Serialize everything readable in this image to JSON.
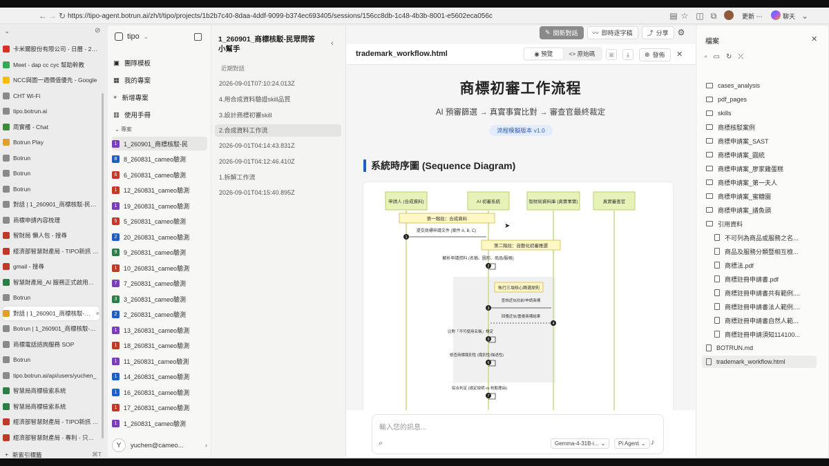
{
  "browser": {
    "url": "https://tipo-agent.botrun.ai/zh/t/tipo/projects/1b2b7c40-8daa-4ddf-9099-b374ec693405/sessions/156cc8db-1c48-4b3b-8001-e5602eca056c",
    "update_label": "更新",
    "chat_label": "聊天",
    "new_tab_label": "新索引標籤",
    "new_tab_shortcut": "⌘T",
    "tabs": [
      {
        "title": "卡米爾股份有限公司 - 日曆 - 2026",
        "color": "#d93025"
      },
      {
        "title": "Meet - dap cc cyc 幫助幹教",
        "color": "#34a853"
      },
      {
        "title": "NCC與圖一週價值優先 - Google",
        "color": "#fbbc04"
      },
      {
        "title": "CHT Wi-Fi",
        "color": "#8a8a8a"
      },
      {
        "title": "tipo.botrun.ai",
        "color": "#8a8a8a"
      },
      {
        "title": "周實穫 - Chat",
        "color": "#3c8c3c"
      },
      {
        "title": "Botrun Play",
        "color": "#e0a030"
      },
      {
        "title": "Botrun",
        "color": "#8a8a8a"
      },
      {
        "title": "Botrun",
        "color": "#8a8a8a"
      },
      {
        "title": "Botrun",
        "color": "#8a8a8a"
      },
      {
        "title": "對話 | 1_260901_商標核駁-民眾問",
        "color": "#8a8a8a"
      },
      {
        "title": "商標申請內容梳理",
        "color": "#8a8a8a"
      },
      {
        "title": "智財局 懶人包 - 搜尋",
        "color": "#c0392b"
      },
      {
        "title": "經濟部智慧財產局 - TIPO新訊 - 智",
        "color": "#c0392b"
      },
      {
        "title": "gmail - 搜尋",
        "color": "#c0392b"
      },
      {
        "title": "智慧財產局_AI 服務正式啟用暨顧問",
        "color": "#2d7d46"
      },
      {
        "title": "Botrun",
        "color": "#8a8a8a"
      },
      {
        "title": "對話 | 1_260901_商標核駁-民眾",
        "color": "#e0a030"
      },
      {
        "title": "Botrun | 1_260901_商標核駁-民眾",
        "color": "#8a8a8a"
      },
      {
        "title": "商標電話諮詢服務 SOP",
        "color": "#8a8a8a"
      },
      {
        "title": "Botrun",
        "color": "#8a8a8a"
      },
      {
        "title": "tipo.botrun.ai/api/users/yuchen_",
        "color": "#8a8a8a"
      },
      {
        "title": "智慧局商標檢索系統",
        "color": "#2d7d46"
      },
      {
        "title": "智慧局商標檢索系統",
        "color": "#2d7d46"
      },
      {
        "title": "經濟部智慧財產局 - TIPO新訊 - 智",
        "color": "#c0392b"
      },
      {
        "title": "經濟部智慧財產局 - 專利 - 只要30",
        "color": "#c0392b"
      }
    ],
    "selected_tab": 17
  },
  "sidebar": {
    "brand": "tipo",
    "nav": [
      {
        "label": "團隊模板",
        "icon": "team-icon"
      },
      {
        "label": "我的專案",
        "icon": "grid-icon"
      },
      {
        "label": "新增專案",
        "icon": "plus-icon"
      },
      {
        "label": "使用手冊",
        "icon": "book-icon"
      }
    ],
    "section_label": "專案",
    "projects": [
      {
        "num": "1",
        "name": "1_260901_商標核駁-民",
        "color": "#7b3fb5"
      },
      {
        "num": "8",
        "name": "8_260831_cameo驗測",
        "color": "#1f5fc4"
      },
      {
        "num": "6",
        "name": "6_260831_cameo驗測",
        "color": "#c0392b"
      },
      {
        "num": "1",
        "name": "12_260831_cameo驗測",
        "color": "#c0392b"
      },
      {
        "num": "1",
        "name": "19_260831_cameo驗測",
        "color": "#7b3fb5"
      },
      {
        "num": "5",
        "name": "5_260831_cameo驗測",
        "color": "#c0392b"
      },
      {
        "num": "2",
        "name": "20_260831_cameo驗測",
        "color": "#1f5fc4"
      },
      {
        "num": "9",
        "name": "9_260831_cameo驗測",
        "color": "#2d7d46"
      },
      {
        "num": "1",
        "name": "10_260831_cameo驗測",
        "color": "#c0392b"
      },
      {
        "num": "7",
        "name": "7_260831_cameo驗測",
        "color": "#7b3fb5"
      },
      {
        "num": "3",
        "name": "3_260831_cameo驗測",
        "color": "#2d7d46"
      },
      {
        "num": "2",
        "name": "2_260831_cameo驗測",
        "color": "#1f5fc4"
      },
      {
        "num": "1",
        "name": "13_260831_cameo驗測",
        "color": "#7b3fb5"
      },
      {
        "num": "1",
        "name": "18_260831_cameo驗測",
        "color": "#c0392b"
      },
      {
        "num": "1",
        "name": "11_260831_cameo驗測",
        "color": "#7b3fb5"
      },
      {
        "num": "1",
        "name": "14_260831_cameo驗測",
        "color": "#1f5fc4"
      },
      {
        "num": "1",
        "name": "16_260831_cameo驗測",
        "color": "#1f5fc4"
      },
      {
        "num": "1",
        "name": "17_260831_cameo驗測",
        "color": "#c0392b"
      },
      {
        "num": "1",
        "name": "1_260831_cameo驗測",
        "color": "#7b3fb5"
      }
    ],
    "user": {
      "initial": "Y",
      "email": "yuchen@cameo..."
    }
  },
  "sessions": {
    "title": "1_260901_商標核駁-民眾問答小幫手",
    "subtitle": "近期對話",
    "items": [
      "2026-09-01T07:10:24.013Z",
      "4.用合成資料驗證skill品質",
      "3.設計商標初審skill",
      "2.合成資料工作流",
      "2026-09-01T04:14:43.831Z",
      "2026-09-01T04:12:46.410Z",
      "1.拆解工作流",
      "2026-09-01T04:15:40.895Z"
    ],
    "selected": 3
  },
  "main": {
    "toolbar": {
      "new_chat": "開新對話",
      "live_caption": "即時逐字稿",
      "share": "分享"
    },
    "doc_name": "trademark_workflow.html",
    "view_tabs": {
      "preview": "預覽",
      "source": "原始碼"
    },
    "publish": "發佈",
    "doc": {
      "title": "商標初審工作流程",
      "subtitle": "AI 預審篩選 → 真實事實比對 → 審查官最終裁定",
      "version": "流程模擬版本 v1.0",
      "section": "系統時序圖 (Sequence Diagram)"
    },
    "diagram": {
      "actors": [
        "申請人 (合成資料)",
        "AI 初審系統",
        "智財局資料庫 (真實事實)",
        "真實審查官"
      ],
      "phase1": "第一階段：合成資料",
      "msg1": "提交商標申請文件 (案件 A, B, C)",
      "phase2": "第二階段：自動化初審推選",
      "msg2": "解析申請資料 (名稱、圖形、商品/服務)",
      "loop": "執行三項核心篩選原則",
      "msg3": "查詢近似抗前/申請商標",
      "msg4": "回傳近似/重複商標結果",
      "msg5": "比對「不可使用名稱」規定",
      "msg6": "檢查商標識別性 (識別性/描述性)",
      "msg7": "綜合判定 (總定說明 vs 核駁理由)"
    },
    "composer": {
      "placeholder": "輸入您的訊息...",
      "model": "Gemma-4-31B-i...",
      "agent": "Pi Agent"
    }
  },
  "files": {
    "title": "檔案",
    "items": [
      {
        "name": "cases_analysis",
        "type": "folder",
        "indent": 0
      },
      {
        "name": "pdf_pages",
        "type": "folder",
        "indent": 0
      },
      {
        "name": "skills",
        "type": "folder",
        "indent": 0
      },
      {
        "name": "商標核駁案例",
        "type": "folder",
        "indent": 0
      },
      {
        "name": "商標申請案_SAST",
        "type": "folder",
        "indent": 0
      },
      {
        "name": "商標申請案_圓統",
        "type": "folder",
        "indent": 0
      },
      {
        "name": "商標申請案_廖家雞蛋糕",
        "type": "folder",
        "indent": 0
      },
      {
        "name": "商標申請案_第一夫人",
        "type": "folder",
        "indent": 0
      },
      {
        "name": "商標申請案_蜜糖園",
        "type": "folder",
        "indent": 0
      },
      {
        "name": "商標申請案_譜魚頭",
        "type": "folder",
        "indent": 0
      },
      {
        "name": "引用資料",
        "type": "folder-open",
        "indent": 0
      },
      {
        "name": "不可列為商品或服務之名...",
        "type": "file",
        "indent": 1
      },
      {
        "name": "商品及服務分類暨相互檢...",
        "type": "file",
        "indent": 1
      },
      {
        "name": "商標法.pdf",
        "type": "file",
        "indent": 1
      },
      {
        "name": "商標註冊申請書.pdf",
        "type": "file",
        "indent": 1
      },
      {
        "name": "商標註冊申請書共有範例....",
        "type": "file",
        "indent": 1
      },
      {
        "name": "商標註冊申請書法人範例....",
        "type": "file",
        "indent": 1
      },
      {
        "name": "商標註冊申請書自然人範...",
        "type": "file",
        "indent": 1
      },
      {
        "name": "商標註冊申請須知114100...",
        "type": "file",
        "indent": 1
      },
      {
        "name": "BOTRUN.md",
        "type": "file",
        "indent": 0
      },
      {
        "name": "trademark_workflow.html",
        "type": "file",
        "indent": 0
      }
    ],
    "selected": 20
  }
}
